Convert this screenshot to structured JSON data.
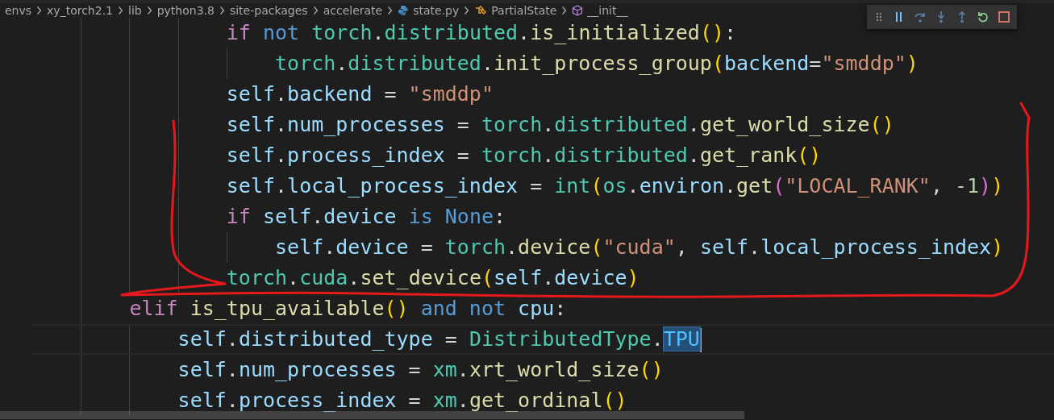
{
  "breadcrumbs": [
    {
      "kind": "folder",
      "label": "envs"
    },
    {
      "kind": "folder",
      "label": "xy_torch2.1"
    },
    {
      "kind": "folder",
      "label": "lib"
    },
    {
      "kind": "folder",
      "label": "python3.8"
    },
    {
      "kind": "folder",
      "label": "site-packages"
    },
    {
      "kind": "folder",
      "label": "accelerate"
    },
    {
      "kind": "python-file",
      "label": "state.py"
    },
    {
      "kind": "class",
      "label": "PartialState"
    },
    {
      "kind": "method",
      "label": "__init__"
    }
  ],
  "debug_toolbar": [
    {
      "kind": "grip"
    },
    {
      "kind": "pause"
    },
    {
      "kind": "step-over"
    },
    {
      "kind": "step-into"
    },
    {
      "kind": "step-out"
    },
    {
      "kind": "restart"
    },
    {
      "kind": "stop"
    }
  ],
  "code_lines": [
    {
      "current": false,
      "tokens": [
        {
          "kind": "control",
          "text": "                if "
        },
        {
          "kind": "keyword",
          "text": "not "
        },
        {
          "kind": "module",
          "text": "torch"
        },
        {
          "kind": "plain",
          "text": "."
        },
        {
          "kind": "module",
          "text": "distributed"
        },
        {
          "kind": "plain",
          "text": "."
        },
        {
          "kind": "function",
          "text": "is_initialized"
        },
        {
          "kind": "bracket",
          "text": "()"
        },
        {
          "kind": "plain",
          "text": ":"
        }
      ]
    },
    {
      "current": false,
      "tokens": [
        {
          "kind": "module",
          "text": "                    torch"
        },
        {
          "kind": "plain",
          "text": "."
        },
        {
          "kind": "module",
          "text": "distributed"
        },
        {
          "kind": "plain",
          "text": "."
        },
        {
          "kind": "function",
          "text": "init_process_group"
        },
        {
          "kind": "bracket",
          "text": "("
        },
        {
          "kind": "variable",
          "text": "backend"
        },
        {
          "kind": "plain",
          "text": "="
        },
        {
          "kind": "string",
          "text": "\"smddp\""
        },
        {
          "kind": "bracket",
          "text": ")"
        }
      ]
    },
    {
      "current": false,
      "tokens": [
        {
          "kind": "variable",
          "text": "                self"
        },
        {
          "kind": "plain",
          "text": "."
        },
        {
          "kind": "variable",
          "text": "backend"
        },
        {
          "kind": "plain",
          "text": " = "
        },
        {
          "kind": "string",
          "text": "\"smddp\""
        }
      ]
    },
    {
      "current": false,
      "tokens": [
        {
          "kind": "variable",
          "text": "                self"
        },
        {
          "kind": "plain",
          "text": "."
        },
        {
          "kind": "variable",
          "text": "num_processes"
        },
        {
          "kind": "plain",
          "text": " = "
        },
        {
          "kind": "module",
          "text": "torch"
        },
        {
          "kind": "plain",
          "text": "."
        },
        {
          "kind": "module",
          "text": "distributed"
        },
        {
          "kind": "plain",
          "text": "."
        },
        {
          "kind": "function",
          "text": "get_world_size"
        },
        {
          "kind": "bracket",
          "text": "()"
        }
      ]
    },
    {
      "current": false,
      "tokens": [
        {
          "kind": "variable",
          "text": "                self"
        },
        {
          "kind": "plain",
          "text": "."
        },
        {
          "kind": "variable",
          "text": "process_index"
        },
        {
          "kind": "plain",
          "text": " = "
        },
        {
          "kind": "module",
          "text": "torch"
        },
        {
          "kind": "plain",
          "text": "."
        },
        {
          "kind": "module",
          "text": "distributed"
        },
        {
          "kind": "plain",
          "text": "."
        },
        {
          "kind": "function",
          "text": "get_rank"
        },
        {
          "kind": "bracket",
          "text": "()"
        }
      ]
    },
    {
      "current": false,
      "tokens": [
        {
          "kind": "variable",
          "text": "                self"
        },
        {
          "kind": "plain",
          "text": "."
        },
        {
          "kind": "variable",
          "text": "local_process_index"
        },
        {
          "kind": "plain",
          "text": " = "
        },
        {
          "kind": "module",
          "text": "int"
        },
        {
          "kind": "bracket",
          "text": "("
        },
        {
          "kind": "module",
          "text": "os"
        },
        {
          "kind": "plain",
          "text": "."
        },
        {
          "kind": "variable",
          "text": "environ"
        },
        {
          "kind": "plain",
          "text": "."
        },
        {
          "kind": "function",
          "text": "get"
        },
        {
          "kind": "bracket-inner",
          "text": "("
        },
        {
          "kind": "string",
          "text": "\"LOCAL_RANK\""
        },
        {
          "kind": "plain",
          "text": ", "
        },
        {
          "kind": "number",
          "text": "-1"
        },
        {
          "kind": "bracket-inner",
          "text": ")"
        },
        {
          "kind": "bracket",
          "text": ")"
        }
      ]
    },
    {
      "current": false,
      "tokens": [
        {
          "kind": "control",
          "text": "                if "
        },
        {
          "kind": "variable",
          "text": "self"
        },
        {
          "kind": "plain",
          "text": "."
        },
        {
          "kind": "variable",
          "text": "device "
        },
        {
          "kind": "keyword",
          "text": "is None"
        },
        {
          "kind": "plain",
          "text": ":"
        }
      ]
    },
    {
      "current": false,
      "tokens": [
        {
          "kind": "variable",
          "text": "                    self"
        },
        {
          "kind": "plain",
          "text": "."
        },
        {
          "kind": "variable",
          "text": "device"
        },
        {
          "kind": "plain",
          "text": " = "
        },
        {
          "kind": "module",
          "text": "torch"
        },
        {
          "kind": "plain",
          "text": "."
        },
        {
          "kind": "function",
          "text": "device"
        },
        {
          "kind": "bracket",
          "text": "("
        },
        {
          "kind": "string",
          "text": "\"cuda\""
        },
        {
          "kind": "plain",
          "text": ", "
        },
        {
          "kind": "variable",
          "text": "self"
        },
        {
          "kind": "plain",
          "text": "."
        },
        {
          "kind": "variable",
          "text": "local_process_index"
        },
        {
          "kind": "bracket",
          "text": ")"
        }
      ]
    },
    {
      "current": false,
      "tokens": [
        {
          "kind": "module",
          "text": "                torch"
        },
        {
          "kind": "plain",
          "text": "."
        },
        {
          "kind": "module",
          "text": "cuda"
        },
        {
          "kind": "plain",
          "text": "."
        },
        {
          "kind": "function",
          "text": "set_device"
        },
        {
          "kind": "bracket",
          "text": "("
        },
        {
          "kind": "variable",
          "text": "self"
        },
        {
          "kind": "plain",
          "text": "."
        },
        {
          "kind": "variable",
          "text": "device"
        },
        {
          "kind": "bracket",
          "text": ")"
        }
      ]
    },
    {
      "current": false,
      "tokens": [
        {
          "kind": "control",
          "text": "        elif "
        },
        {
          "kind": "function",
          "text": "is_tpu_available"
        },
        {
          "kind": "bracket",
          "text": "()"
        },
        {
          "kind": "keyword",
          "text": " and not "
        },
        {
          "kind": "variable",
          "text": "cpu"
        },
        {
          "kind": "plain",
          "text": ":"
        }
      ]
    },
    {
      "current": true,
      "tokens": [
        {
          "kind": "variable",
          "text": "            self"
        },
        {
          "kind": "plain",
          "text": "."
        },
        {
          "kind": "variable",
          "text": "distributed_type"
        },
        {
          "kind": "plain",
          "text": " = "
        },
        {
          "kind": "module",
          "text": "DistributedType"
        },
        {
          "kind": "plain",
          "text": "."
        },
        {
          "kind": "constant",
          "text": "TPU",
          "highlight": true
        }
      ]
    },
    {
      "current": false,
      "tokens": [
        {
          "kind": "variable",
          "text": "            self"
        },
        {
          "kind": "plain",
          "text": "."
        },
        {
          "kind": "variable",
          "text": "num_processes"
        },
        {
          "kind": "plain",
          "text": " = "
        },
        {
          "kind": "module",
          "text": "xm"
        },
        {
          "kind": "plain",
          "text": "."
        },
        {
          "kind": "function",
          "text": "xrt_world_size"
        },
        {
          "kind": "bracket",
          "text": "()"
        }
      ]
    },
    {
      "current": false,
      "tokens": [
        {
          "kind": "variable",
          "text": "            self"
        },
        {
          "kind": "plain",
          "text": "."
        },
        {
          "kind": "variable",
          "text": "process_index"
        },
        {
          "kind": "plain",
          "text": " = "
        },
        {
          "kind": "module",
          "text": "xm"
        },
        {
          "kind": "plain",
          "text": "."
        },
        {
          "kind": "function",
          "text": "get_ordinal"
        },
        {
          "kind": "bracket",
          "text": "()"
        }
      ]
    }
  ],
  "annotations": [
    {
      "kind": "freehand-loop"
    }
  ]
}
